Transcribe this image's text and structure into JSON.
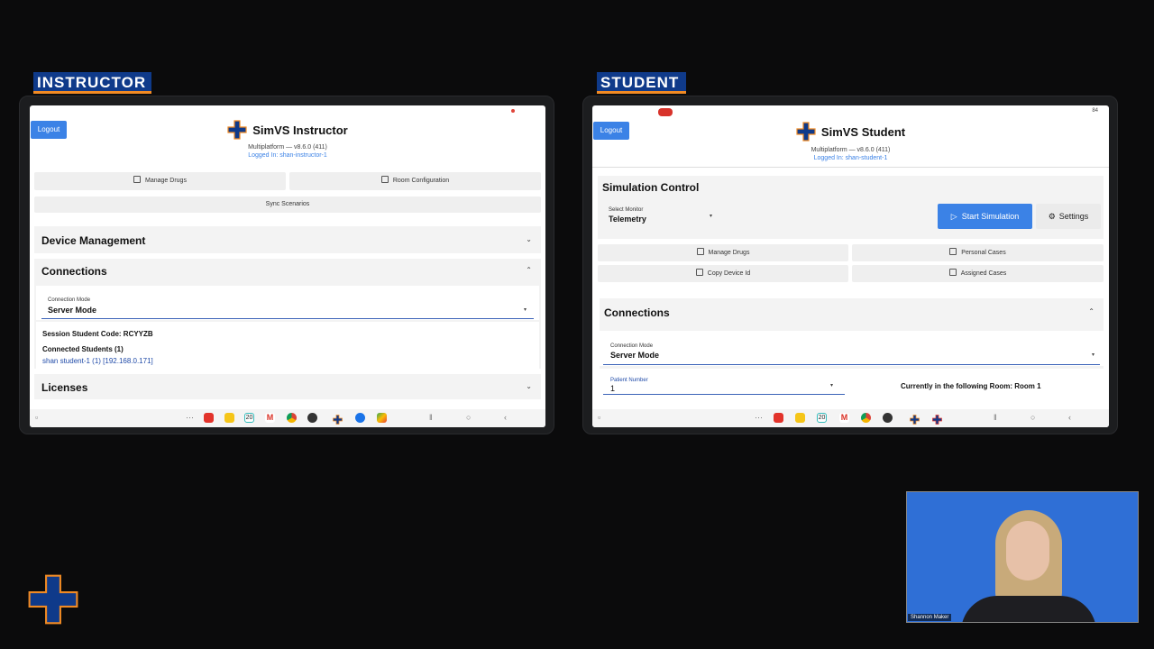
{
  "labels": {
    "instructor": "INSTRUCTOR",
    "student": "STUDENT"
  },
  "instructor": {
    "logout": "Logout",
    "title": "SimVS Instructor",
    "version": "Multiplatform — v8.6.0 (411)",
    "logged_in": "Logged In: shan-instructor-1",
    "buttons": {
      "manage_drugs": "Manage Drugs",
      "room_config": "Room Configuration",
      "sync": "Sync Scenarios"
    },
    "device_management": "Device Management",
    "connections": {
      "title": "Connections",
      "mode_label": "Connection Mode",
      "mode_value": "Server Mode",
      "session_code": "Session Student Code: RCYYZB",
      "connected_title": "Connected Students (1)",
      "student_entry": "shan student-1 (1) [192.168.0.171]"
    },
    "licenses": "Licenses"
  },
  "student": {
    "logout": "Logout",
    "title": "SimVS Student",
    "version": "Multiplatform — v8.6.0 (411)",
    "logged_in": "Logged In: shan-student-1",
    "simulation_control": "Simulation Control",
    "monitor_label": "Select Monitor",
    "monitor_value": "Telemetry",
    "start_simulation": "Start Simulation",
    "settings": "Settings",
    "buttons": {
      "manage_drugs": "Manage Drugs",
      "personal_cases": "Personal Cases",
      "copy_device": "Copy Device Id",
      "assigned_cases": "Assigned Cases"
    },
    "connections": {
      "title": "Connections",
      "mode_label": "Connection Mode",
      "mode_value": "Server Mode",
      "patient_label": "Patient Number",
      "patient_value": "1",
      "room_text": "Currently in the following Room:  Room 1"
    },
    "status_battery": "84"
  },
  "taskbar": {
    "calendar_day": "20"
  },
  "webcam": {
    "name": "Shannon Maker"
  },
  "colors": {
    "accent": "#3b82e6",
    "label_bg": "#0f3a8a",
    "label_border": "#f08a24",
    "logo_blue": "#0f3a8a",
    "logo_orange": "#f08a24"
  }
}
